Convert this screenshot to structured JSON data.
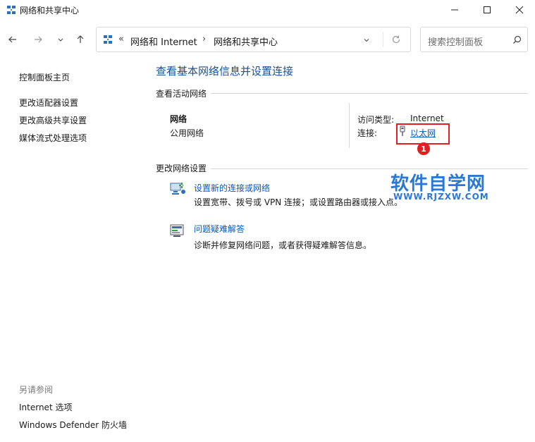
{
  "window": {
    "title": "网络和共享中心"
  },
  "nav": {
    "breadcrumb_overflow": "«",
    "crumbs": [
      "网络和 Internet",
      "网络和共享中心"
    ],
    "crumb_separator": "›",
    "search_placeholder": "搜索控制面板"
  },
  "left_pane": {
    "links": [
      "控制面板主页",
      "更改适配器设置",
      "更改高级共享设置",
      "媒体流式处理选项"
    ],
    "see_also_label": "另请参阅",
    "see_also": [
      "Internet 选项",
      "Windows Defender 防火墙"
    ]
  },
  "main": {
    "heading": "查看基本网络信息并设置连接",
    "active_networks_label": "查看活动网络",
    "network": {
      "name": "网络",
      "category": "公用网络",
      "access_type_label": "访问类型:",
      "access_type_value": "Internet",
      "connections_label": "连接:",
      "connection_link": "以太网"
    },
    "change_settings_label": "更改网络设置",
    "tasks": [
      {
        "title": "设置新的连接或网络",
        "description": "设置宽带、拨号或 VPN 连接；或设置路由器或接入点。",
        "icon": "new-connection-icon"
      },
      {
        "title": "问题疑难解答",
        "description": "诊断并修复网络问题，或者获得疑难解答信息。",
        "icon": "troubleshoot-icon"
      }
    ]
  },
  "annotation": {
    "badge": "1",
    "color": "#e02020"
  },
  "watermark": {
    "main": "软件自学网",
    "sub": "WWW.RJZXW.COM"
  },
  "colors": {
    "heading": "#1f4f8c",
    "link": "#0b58b8",
    "watermark": "#2a78d6"
  }
}
